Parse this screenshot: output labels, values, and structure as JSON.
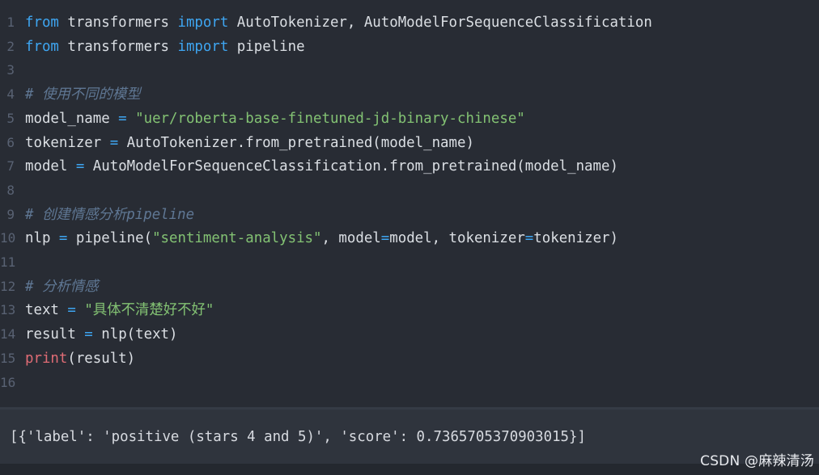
{
  "code_lines": [
    {
      "number": "1",
      "tokens": [
        {
          "text": "from",
          "type": "kw"
        },
        {
          "text": " transformers ",
          "type": "plain"
        },
        {
          "text": "import",
          "type": "kw"
        },
        {
          "text": " AutoTokenizer, AutoModelForSequenceClassification",
          "type": "plain"
        }
      ]
    },
    {
      "number": "2",
      "tokens": [
        {
          "text": "from",
          "type": "kw"
        },
        {
          "text": " transformers ",
          "type": "plain"
        },
        {
          "text": "import",
          "type": "kw"
        },
        {
          "text": " pipeline",
          "type": "plain"
        }
      ]
    },
    {
      "number": "3",
      "tokens": []
    },
    {
      "number": "4",
      "tokens": [
        {
          "text": "# 使用不同的模型",
          "type": "cm"
        }
      ]
    },
    {
      "number": "5",
      "tokens": [
        {
          "text": "model_name ",
          "type": "plain"
        },
        {
          "text": "=",
          "type": "op"
        },
        {
          "text": " ",
          "type": "plain"
        },
        {
          "text": "\"uer/roberta-base-finetuned-jd-binary-chinese\"",
          "type": "str"
        }
      ]
    },
    {
      "number": "6",
      "tokens": [
        {
          "text": "tokenizer ",
          "type": "plain"
        },
        {
          "text": "=",
          "type": "op"
        },
        {
          "text": " AutoTokenizer.from_pretrained(model_name)",
          "type": "plain"
        }
      ]
    },
    {
      "number": "7",
      "tokens": [
        {
          "text": "model ",
          "type": "plain"
        },
        {
          "text": "=",
          "type": "op"
        },
        {
          "text": " AutoModelForSequenceClassification.from_pretrained(model_name)",
          "type": "plain"
        }
      ]
    },
    {
      "number": "8",
      "tokens": []
    },
    {
      "number": "9",
      "tokens": [
        {
          "text": "# 创建情感分析pipeline",
          "type": "cm"
        }
      ]
    },
    {
      "number": "10",
      "tokens": [
        {
          "text": "nlp ",
          "type": "plain"
        },
        {
          "text": "=",
          "type": "op"
        },
        {
          "text": " pipeline(",
          "type": "plain"
        },
        {
          "text": "\"sentiment-analysis\"",
          "type": "str"
        },
        {
          "text": ", model",
          "type": "plain"
        },
        {
          "text": "=",
          "type": "op"
        },
        {
          "text": "model, tokenizer",
          "type": "plain"
        },
        {
          "text": "=",
          "type": "op"
        },
        {
          "text": "tokenizer)",
          "type": "plain"
        }
      ]
    },
    {
      "number": "11",
      "tokens": []
    },
    {
      "number": "12",
      "tokens": [
        {
          "text": "# 分析情感",
          "type": "cm"
        }
      ]
    },
    {
      "number": "13",
      "tokens": [
        {
          "text": "text ",
          "type": "plain"
        },
        {
          "text": "=",
          "type": "op"
        },
        {
          "text": " ",
          "type": "plain"
        },
        {
          "text": "\"具体不清楚好不好\"",
          "type": "str"
        }
      ]
    },
    {
      "number": "14",
      "tokens": [
        {
          "text": "result ",
          "type": "plain"
        },
        {
          "text": "=",
          "type": "op"
        },
        {
          "text": " nlp(text)",
          "type": "plain"
        }
      ]
    },
    {
      "number": "15",
      "tokens": [
        {
          "text": "print",
          "type": "fn"
        },
        {
          "text": "(result)",
          "type": "plain"
        }
      ]
    },
    {
      "number": "16",
      "tokens": []
    }
  ],
  "output": {
    "text": "[{'label': 'positive (stars 4 and 5)', 'score': 0.7365705370903015}]"
  },
  "watermark": {
    "text": "CSDN @麻辣清汤"
  },
  "colors": {
    "background": "#282c34",
    "keyword": "#3ea6f2",
    "string": "#83c273",
    "comment": "#5f7794",
    "builtin": "#e06c75",
    "text": "#dbdfe4"
  }
}
